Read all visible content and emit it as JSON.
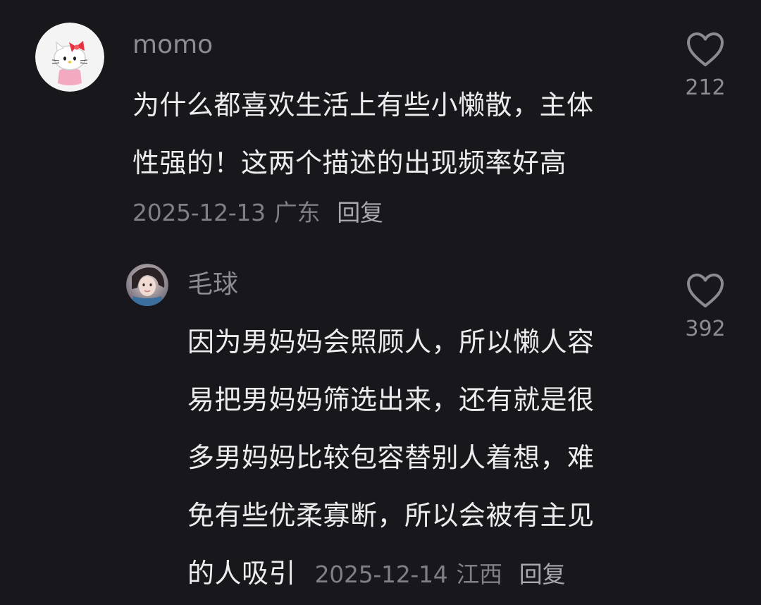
{
  "comments": [
    {
      "username": "momo",
      "text_lines": [
        "为什么都喜欢生活上有些小懒散，主体",
        "性强的！这两个描述的出现频率好高"
      ],
      "date": "2025-12-13",
      "location": "广东",
      "reply_label": "回复",
      "likes": "212",
      "avatar_icon": "hello-kitty-avatar-icon",
      "like_icon": "heart-outline-icon"
    },
    {
      "username": "毛球",
      "text_lines": [
        "因为男妈妈会照顾人，所以懒人容",
        "易把男妈妈筛选出来，还有就是很",
        "多男妈妈比较包容替别人着想，难",
        "免有些优柔寡断，所以会被有主见",
        "的人吸引"
      ],
      "date": "2025-12-14",
      "location": "江西",
      "reply_label": "回复",
      "likes": "392",
      "avatar_icon": "portrait-photo-avatar-icon",
      "like_icon": "heart-outline-icon"
    }
  ],
  "colors": {
    "background": "#17171c",
    "username": "#8c8c91",
    "text": "#ececee",
    "meta": "#7f7f84"
  }
}
